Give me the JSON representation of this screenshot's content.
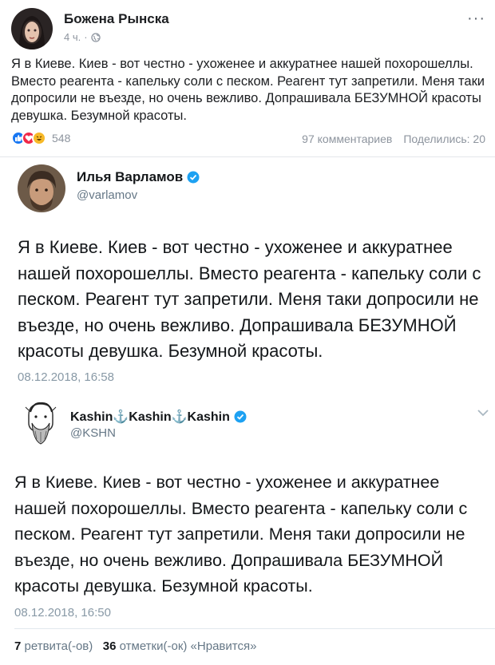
{
  "fb_post": {
    "author": "Божена Рынска",
    "time": "4 ч.",
    "separator": "·",
    "more": "···",
    "text": "Я в Киеве. Киев - вот честно - ухоженее и аккуратнее нашей похорошеллы. Вместо реагента - капельку соли с песком. Реагент тут запретили. Меня таки допросили не въезде, но очень вежливо. Допрашивала БЕЗУМНОЙ красоты девушка. Безумной красоты.",
    "reactions_count": "548",
    "comments": "97 комментариев",
    "shares": "Поделились: 20",
    "icons": [
      "like-icon",
      "love-icon",
      "haha-icon",
      "globe-icon",
      "more-options-icon"
    ]
  },
  "tweet1": {
    "name": "Илья Варламов",
    "handle": "@varlamov",
    "text": "Я в Киеве. Киев - вот честно - ухоженее и аккуратнее нашей похорошеллы. Вместо реагента - капельку соли с песком. Реагент тут запретили. Меня таки допросили не въезде, но очень вежливо. Допрашивала БЕЗУМНОЙ красоты девушка. Безумной красоты.",
    "date": "08.12.2018, 16:58"
  },
  "tweet2": {
    "name": "Kashin⚓Kashin⚓Kashin",
    "handle": "@KSHN",
    "text": "Я в Киеве. Киев - вот честно - ухоженее и аккуратнее нашей похорошеллы. Вместо реагента - капельку соли с песком. Реагент тут запретили. Меня таки допросили не въезде, но очень вежливо. Допрашивала БЕЗУМНОЙ красоты девушка. Безумной красоты.",
    "date": "08.12.2018, 16:50",
    "retweets_count": "7",
    "retweets_label": "ретвита(-ов)",
    "likes_count": "36",
    "likes_label": "отметки(-ок) «Нравится»"
  },
  "colors": {
    "fb_blue": "#1877f2",
    "twitter_verified": "#1da1f2",
    "muted": "#8d949e"
  }
}
